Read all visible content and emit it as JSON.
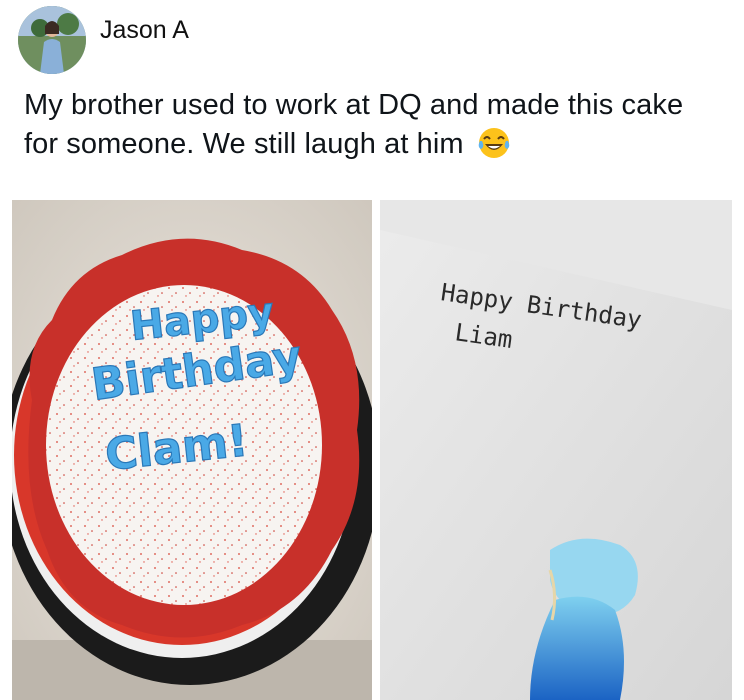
{
  "post": {
    "author": "Jason A",
    "text": "My brother used to work at DQ and made this cake for someone. We still laugh at him",
    "emoji": "face-with-tears-of-joy"
  },
  "images": {
    "cake": {
      "line1": "Happy",
      "line2": "Birthday",
      "line3": "Clam!"
    },
    "note": {
      "line1": "Happy Birthday",
      "line2": "Liam"
    }
  },
  "colors": {
    "frosting_red": "#d8372a",
    "icing_blue": "#4aa9e6",
    "cake_white": "#f5f3f1"
  }
}
